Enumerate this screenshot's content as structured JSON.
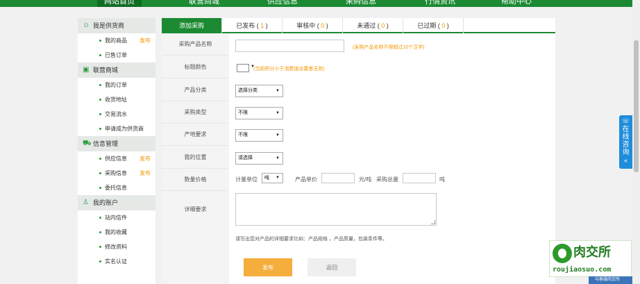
{
  "top_nav": [
    "网站首页",
    "联营商城",
    "供应信息",
    "采购信息",
    "行情资讯",
    "帮助中心"
  ],
  "sidebar": {
    "groups": [
      {
        "title": "我是供货商",
        "icon": "supplier-icon",
        "items": [
          {
            "label": "我的商品",
            "badge": "发布"
          },
          {
            "label": "已售订单",
            "badge": ""
          }
        ]
      },
      {
        "title": "联营商城",
        "icon": "shop-icon",
        "items": [
          {
            "label": "我的订单",
            "badge": ""
          },
          {
            "label": "收货地址",
            "badge": ""
          },
          {
            "label": "交易流水",
            "badge": ""
          },
          {
            "label": "申请成为供货商",
            "badge": ""
          }
        ]
      },
      {
        "title": "信息管理",
        "icon": "cart-icon",
        "items": [
          {
            "label": "供应信息",
            "badge": "发布"
          },
          {
            "label": "采购信息",
            "badge": "发布"
          },
          {
            "label": "委托信息",
            "badge": ""
          }
        ]
      },
      {
        "title": "我的账户",
        "icon": "user-icon",
        "items": [
          {
            "label": "站内信件",
            "badge": ""
          },
          {
            "label": "我的收藏",
            "badge": ""
          },
          {
            "label": "修改资料",
            "badge": ""
          },
          {
            "label": "实名认证",
            "badge": ""
          }
        ]
      }
    ]
  },
  "tabs": [
    {
      "label": "添加采购",
      "count": ""
    },
    {
      "label": "已发布",
      "count": "1"
    },
    {
      "label": "审核中",
      "count": "0"
    },
    {
      "label": "未通过",
      "count": "0"
    },
    {
      "label": "已过期",
      "count": "0"
    }
  ],
  "form": {
    "product_name_label": "采购产品名称",
    "product_name_hint": "(采购产品名称不得超过10个汉字)",
    "title_color_label": "标题颜色",
    "title_color_hint": "(当前积分小于消费值设置者无效)",
    "category_label": "产品分类",
    "category_value": "选择分类",
    "purchase_type_label": "采购类型",
    "purchase_type_value": "不限",
    "origin_label": "产地要求",
    "origin_value": "不限",
    "location_label": "我的位置",
    "location_value": "请选择",
    "qty_price_label": "数量价格",
    "unit_label": "计量单位",
    "unit_value": "吨",
    "unit_price_label": "产品单价",
    "unit_price_suffix": "元/吨",
    "total_label": "采购总量",
    "total_suffix": "吨",
    "detail_label": "详细要求",
    "detail_hint": "请写出您对产品的详细要求比如：产品规格 ，产品质量，包装条件等。",
    "publish_button": "发布",
    "back_button": "返回"
  },
  "online_service": {
    "label": "在线咨询",
    "chevron": "«"
  },
  "logo": {
    "name_cn": "肉交所",
    "domain": "roujiaosuo.com",
    "footer": "与客服肉交所"
  }
}
